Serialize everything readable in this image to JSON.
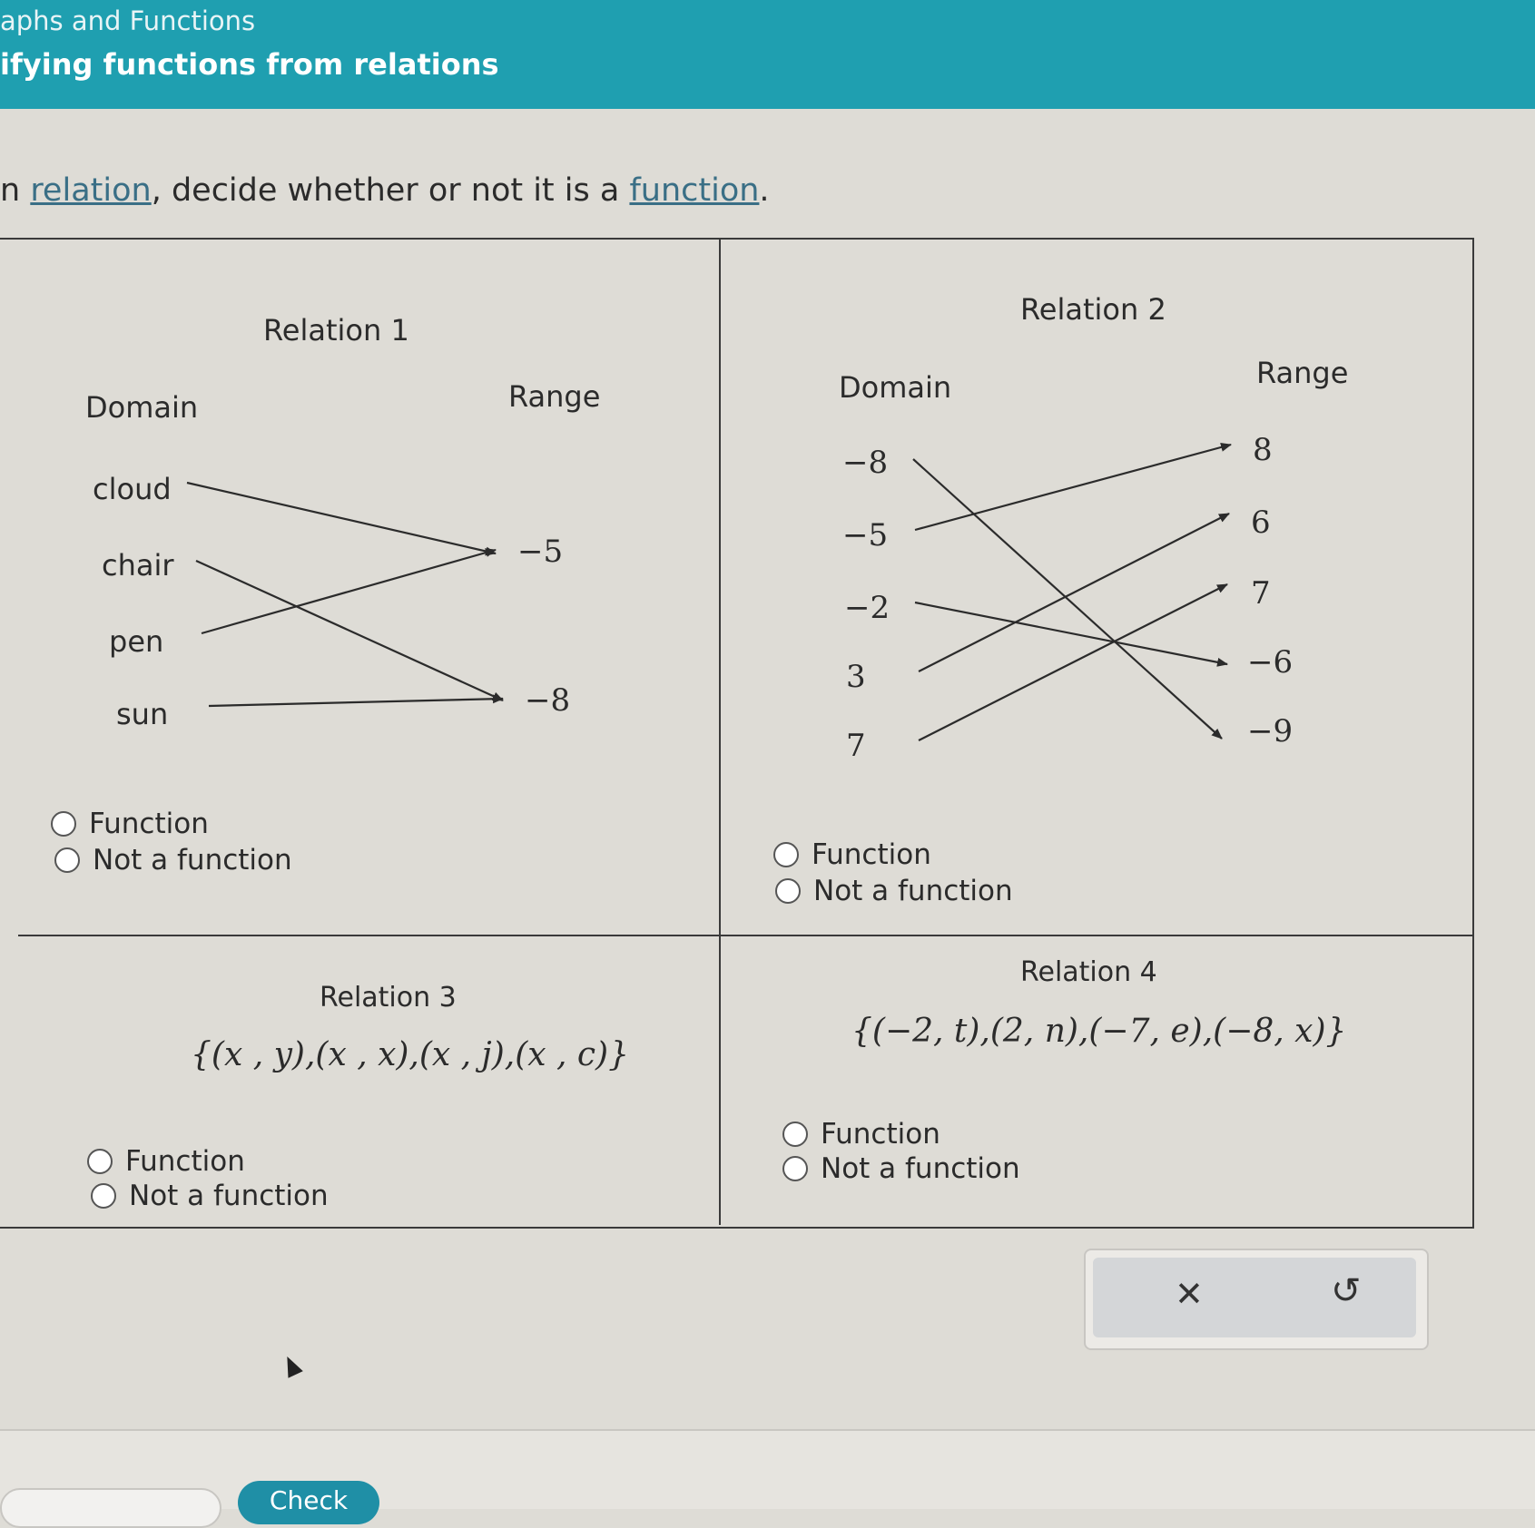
{
  "header": {
    "category": "aphs and Functions",
    "topic": "ifying functions from relations"
  },
  "prompt": {
    "prefix": "n ",
    "relation_link": "relation",
    "middle": ", decide whether or not it is a ",
    "function_link": "function",
    "suffix": "."
  },
  "relation1": {
    "title": "Relation 1",
    "domain_label": "Domain",
    "range_label": "Range",
    "domain": [
      "cloud",
      "chair",
      "pen",
      "sun"
    ],
    "range": [
      "−5",
      "−8"
    ],
    "options": [
      "Function",
      "Not a function"
    ]
  },
  "relation2": {
    "title": "Relation 2",
    "domain_label": "Domain",
    "range_label": "Range",
    "domain": [
      "−8",
      "−5",
      "−2",
      "3",
      "7"
    ],
    "range": [
      "8",
      "6",
      "7",
      "−6",
      "−9"
    ],
    "options": [
      "Function",
      "Not a function"
    ]
  },
  "relation3": {
    "title": "Relation 3",
    "set": "{(x , y),(x , x),(x , j),(x , c)}",
    "options": [
      "Function",
      "Not a function"
    ]
  },
  "relation4": {
    "title": "Relation 4",
    "set": "{(−2, t),(2, n),(−7, e),(−8, x)}",
    "options": [
      "Function",
      "Not a function"
    ]
  },
  "actions": {
    "clear_symbol": "✕",
    "undo_symbol": "↺"
  },
  "footer": {
    "check_label": "Check"
  }
}
